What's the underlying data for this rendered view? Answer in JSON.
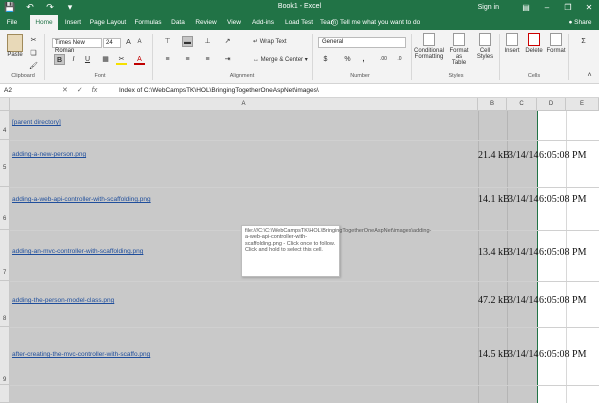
{
  "titlebar": {
    "title": "Book1 - Excel",
    "save_icon": "save-icon",
    "undo_icon": "undo-icon",
    "redo_icon": "redo-icon",
    "sign_in": "Sign in"
  },
  "tabs": [
    "File",
    "Home",
    "Insert",
    "Page Layout",
    "Formulas",
    "Data",
    "Review",
    "View",
    "Add-ins",
    "Load Test",
    "Team"
  ],
  "active_tab": "Home",
  "tell_me": "Tell me what you want to do",
  "ribbon": {
    "clipboard": {
      "paste": "Paste",
      "label": "Clipboard"
    },
    "font": {
      "name": "Times New Roman",
      "size": "24",
      "bold": "B",
      "italic": "I",
      "underline": "U",
      "label": "Font"
    },
    "alignment": {
      "wrap_text": "Wrap Text",
      "merge_center": "Merge & Center",
      "label": "Alignment"
    },
    "number": {
      "format": "General",
      "currency": "$",
      "percent": "%",
      "comma": ",",
      "inc_dec": ".00",
      "label": "Number"
    },
    "styles": {
      "conditional": "Conditional",
      "formatting": "Formatting",
      "format_as": "Format as",
      "table": "Table",
      "cell": "Cell",
      "styles": "Styles",
      "label": "Styles"
    },
    "cells": {
      "insert": "Insert",
      "delete": "Delete",
      "format": "Format",
      "label": "Cells"
    }
  },
  "formula_bar": {
    "name_box": "A2",
    "cancel": "✕",
    "enter": "✓",
    "fx": "fx",
    "content": "Index of C:\\WebCampsTK\\HOL\\BringingTogetherOneAspNet\\images\\"
  },
  "columns": [
    "A",
    "B",
    "C",
    "D",
    "E"
  ],
  "rows": [
    {
      "num": "4",
      "name": "[parent directory]",
      "size": "",
      "date": "",
      "time": ""
    },
    {
      "num": "5",
      "name": "adding-a-new-person.png",
      "size": "21.4 kB",
      "date": "3/14/14",
      "time": "6:05:08 PM"
    },
    {
      "num": "6",
      "name": "adding-a-web-api-controller-with-scaffolding.png",
      "size": "14.1 kB",
      "date": "3/14/14",
      "time": "6:05:08 PM"
    },
    {
      "num": "7",
      "name": "adding-an-mvc-controller-with-scaffolding.png",
      "size": "13.4 kB",
      "date": "3/14/14",
      "time": "6:05:08 PM"
    },
    {
      "num": "8",
      "name": "adding-the-person-model-class.png",
      "size": "47.2 kB",
      "date": "3/14/14",
      "time": "6:05:08 PM"
    },
    {
      "num": "9",
      "name": "after-creating-the-mvc-controller-with-scaffo.png",
      "size": "14.5 kB",
      "date": "3/14/14",
      "time": "6:05:08 PM"
    }
  ],
  "tooltip": "file:///C:\\C:\\WebCampsTK\\HOL\\BringingTogetherOneAspNet\\images\\adding-a-web-api-controller-with-scaffolding.png - Click once to follow. Click and hold to select this cell."
}
